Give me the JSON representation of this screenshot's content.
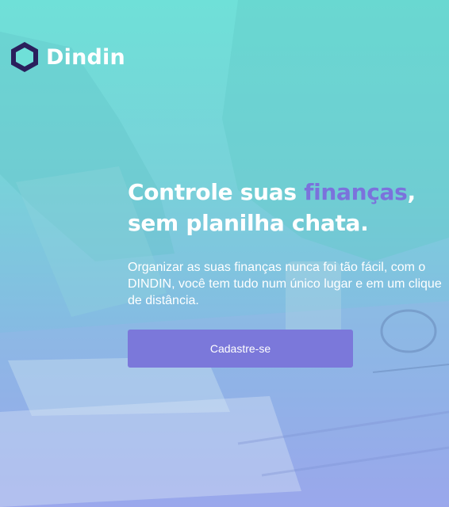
{
  "brand": {
    "name": "Dindin",
    "logo_icon": "hexagon-logo-icon"
  },
  "hero": {
    "headline_part1": "Controle suas ",
    "headline_highlight": "finanças",
    "headline_part2": ",",
    "headline_line2": "sem planilha chata.",
    "description": "Organizar as suas finanças nunca foi tão fácil, com o DINDIN, você tem tudo num único lugar e em um clique de distância."
  },
  "cta": {
    "label": "Cadastre-se"
  },
  "colors": {
    "accent": "#7b72dc",
    "button": "#7b78da",
    "logo_dark": "#2a1f5c",
    "text": "#ffffff"
  }
}
